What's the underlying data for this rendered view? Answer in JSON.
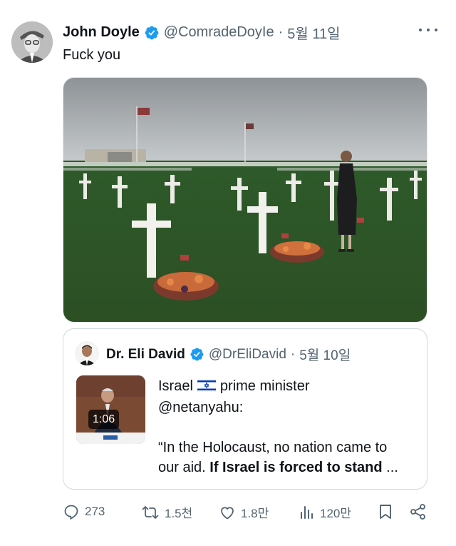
{
  "post": {
    "author_name": "John Doyle",
    "handle": "@ComradeDoyIe",
    "separator": "·",
    "date": "5월 11일",
    "text": "Fuck you"
  },
  "quote": {
    "author_name": "Dr. Eli David",
    "handle": "@DrEliDavid",
    "separator": "·",
    "date": "5월 10일",
    "video_duration": "1:06",
    "line1_before_flag": "Israel",
    "line1_after_flag": "prime minister",
    "line2": "@netanyahu:",
    "line3": "“In the Holocaust, no nation came to",
    "line4_normal": "our aid.",
    "line4_bold": "If Israel is forced to stand",
    "line4_ellipsis": "..."
  },
  "actions": {
    "replies": "273",
    "reposts": "1.5천",
    "likes": "1.8만",
    "views": "120만"
  },
  "colors": {
    "verified": "#1d9bf0",
    "secondary_text": "#536471",
    "border": "#cfd9de",
    "flag_blue": "#0038b8"
  },
  "icons": [
    "verified-badge-icon",
    "more-icon",
    "reply-icon",
    "repost-icon",
    "like-icon",
    "views-icon",
    "bookmark-icon",
    "share-icon"
  ]
}
